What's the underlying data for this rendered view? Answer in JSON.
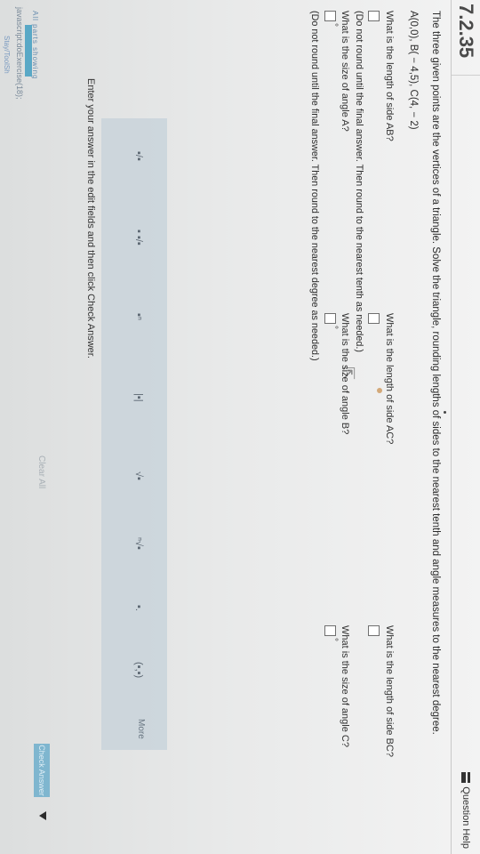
{
  "header": {
    "problem_number": "7.2.35",
    "help_label": "Question Help"
  },
  "problem": {
    "intro": "The three given points are the vertices of a triangle. Solve the triangle, rounding lengths of sides to the nearest tenth and angle measures to the nearest degree.",
    "points": "A(0,0), B( − 4,5), C(4, − 2)"
  },
  "questions": {
    "ab": "What is the length of side AB?",
    "ac": "What is the length of side AC?",
    "bc": "What is the length of side BC?",
    "round_note_tenth": "(Do not round until the final answer. Then round to the nearest tenth as needed.)",
    "angle_a": "What is the size of angle A?",
    "angle_b": "What is the size of angle B?",
    "angle_c": "What is the size of angle C?",
    "round_note_degree": "(Do not round until the final answer. Then round to the nearest degree as needed.)",
    "degree_symbol": "°"
  },
  "toolbar": {
    "symbols": [
      "▪/▪",
      "▪ ▪/▪",
      "▪ⁿ",
      "|▪|",
      "√▪",
      "ⁿ√▪",
      "▪.",
      "(▪,▪)"
    ],
    "more_label": "More"
  },
  "footer": {
    "instructions": "Enter your answer in the edit fields and then click Check Answer.",
    "all_parts": "All parts showing",
    "js_link": "javascript:doExercise(18);",
    "status": "Stay/ToolSh",
    "clear_all": "Clear All",
    "check_answer": "Check Answer"
  }
}
